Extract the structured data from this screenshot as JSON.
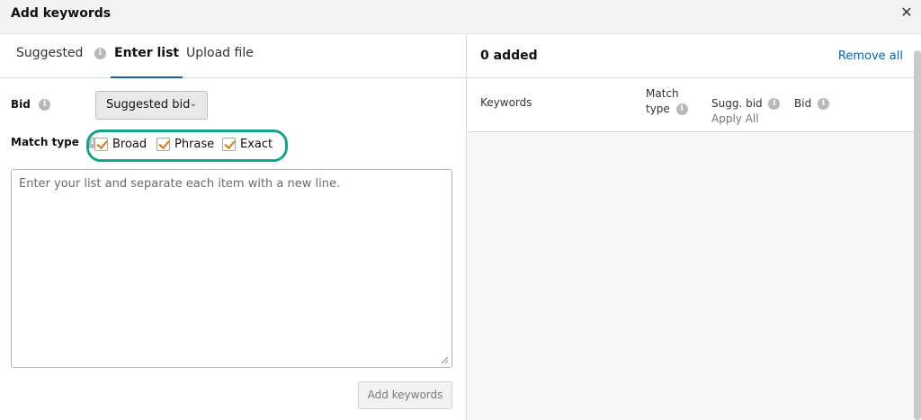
{
  "dialog": {
    "title": "Add keywords",
    "close_symbol": "✕"
  },
  "tabs": [
    {
      "label": "Suggested",
      "active": false
    },
    {
      "label": "Enter list",
      "active": true
    },
    {
      "label": "Upload file",
      "active": false
    }
  ],
  "form": {
    "bid_label": "Bid",
    "bid_value": "Suggested bid",
    "match_type_label": "Match type",
    "match_types": [
      {
        "label": "Broad",
        "checked": true
      },
      {
        "label": "Phrase",
        "checked": true
      },
      {
        "label": "Exact",
        "checked": true
      }
    ],
    "textarea_placeholder": "Enter your list and separate each item with a new line.",
    "add_button": "Add keywords"
  },
  "added_panel": {
    "count_text": "0 added",
    "remove_all": "Remove all",
    "columns": {
      "keywords": "Keywords",
      "match_type_line1": "Match",
      "match_type_line2": "type",
      "sugg_bid": "Sugg. bid",
      "apply_all": "Apply All",
      "bid": "Bid"
    }
  },
  "colors": {
    "accent_link": "#0066c0",
    "checkbox_check": "#e47911",
    "highlight_ring": "#17a38a",
    "tab_underline": "#1d5f8c"
  },
  "icons": {
    "info": "info-icon",
    "close": "close-icon",
    "chevron": "chevron-down-icon"
  }
}
